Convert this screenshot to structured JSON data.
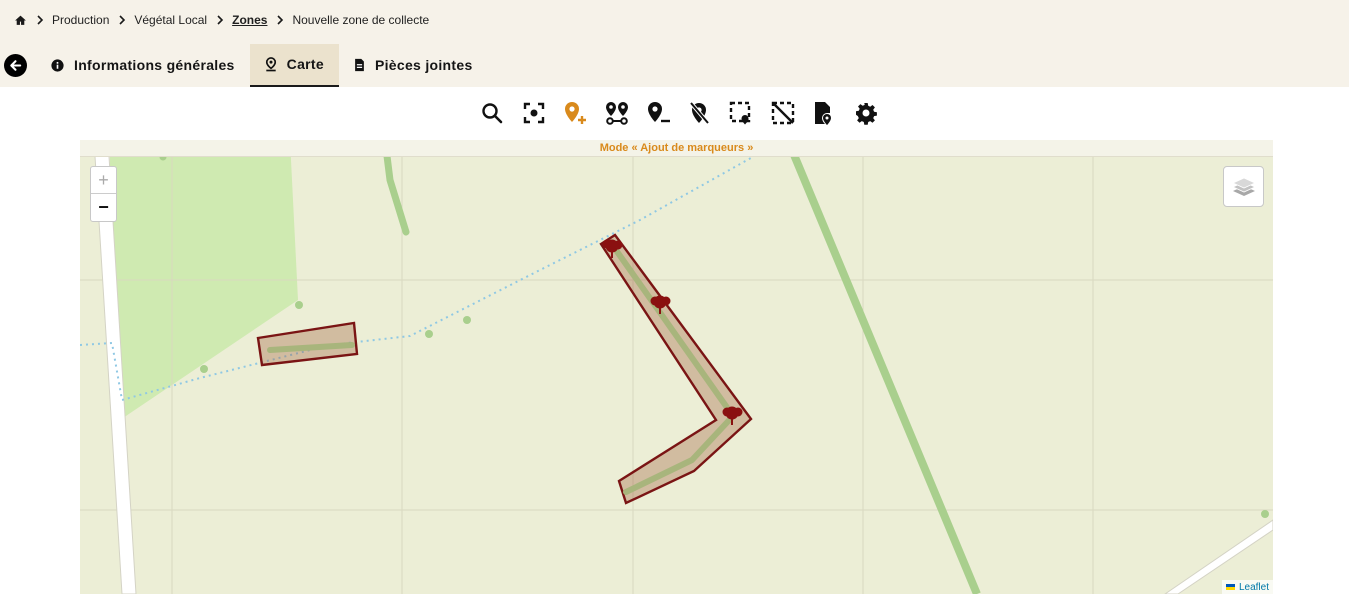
{
  "breadcrumb": {
    "items": [
      "Production",
      "Végétal Local",
      "Zones",
      "Nouvelle zone de collecte"
    ]
  },
  "tabs": [
    {
      "label": "Informations générales",
      "icon": "info-icon",
      "active": false
    },
    {
      "label": "Carte",
      "icon": "map-pin-icon",
      "active": true
    },
    {
      "label": "Pièces jointes",
      "icon": "document-icon",
      "active": false
    }
  ],
  "toolbar": {
    "tools": [
      "search-icon",
      "focus-center-icon",
      "add-marker-icon",
      "route-markers-icon",
      "remove-marker-icon",
      "delete-marker-icon",
      "select-area-icon",
      "deselect-area-icon",
      "export-file-icon",
      "settings-icon"
    ],
    "active_tool": "add-marker-icon",
    "accent": "#d98a1c"
  },
  "map": {
    "mode_label": "Mode « Ajout de marqueurs »",
    "zoom_in": "+",
    "zoom_out": "−",
    "attribution": "Leaflet",
    "zone_color": "#7a1414",
    "marker_count": 3
  }
}
